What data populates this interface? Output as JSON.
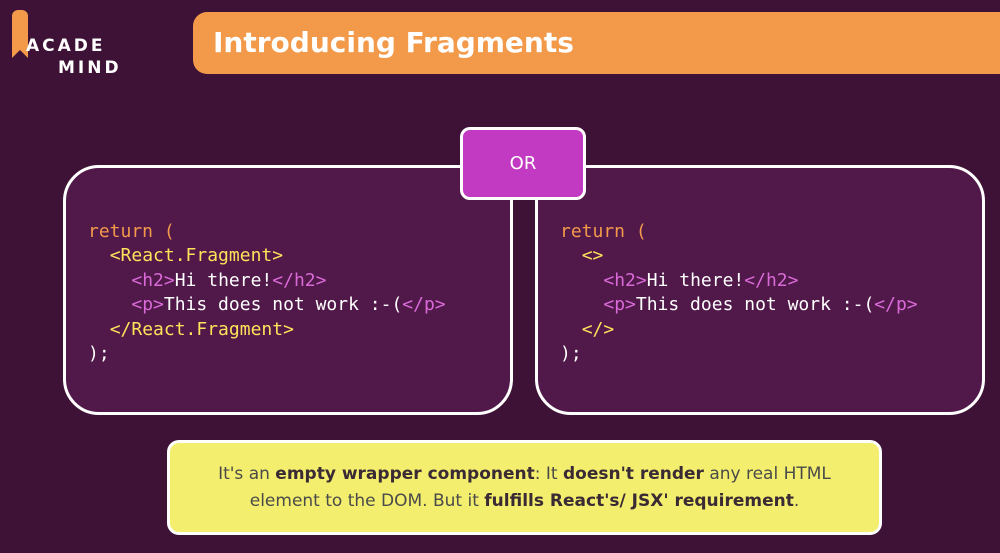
{
  "logo": {
    "line1": "ACADE",
    "line2": "MIND"
  },
  "title": "Introducing Fragments",
  "or_label": "OR",
  "left_code": {
    "l1_kw": "return (",
    "l2_tag": "<React.Fragment>",
    "l3_open": "<h2>",
    "l3_text": "Hi there!",
    "l3_close": "</h2>",
    "l4_open": "<p>",
    "l4_text": "This does not work :-(",
    "l4_close": "</p>",
    "l5_tag": "</React.Fragment>",
    "l6": ");"
  },
  "right_code": {
    "l1_kw": "return (",
    "l2_tag": "<>",
    "l3_open": "<h2>",
    "l3_text": "Hi there!",
    "l3_close": "</h2>",
    "l4_open": "<p>",
    "l4_text": "This does not work :-(",
    "l4_close": "</p>",
    "l5_tag": "</>",
    "l6": ");"
  },
  "note": {
    "part1": "It's an ",
    "bold1": "empty wrapper component",
    "part2": ": It ",
    "bold2": "doesn't render",
    "part3": " any real HTML element to the DOM. But it ",
    "bold3": "fulfills React's/ JSX' requirement",
    "part4": "."
  },
  "colors": {
    "background": "#3e1136",
    "box": "#51194a",
    "title_bar": "#f2994a",
    "or_badge": "#c33ac2",
    "note_bg": "#f3ee6e",
    "keyword": "#f2994a",
    "tag_yellow": "#ffe15a",
    "tag_pink": "#d96ad8"
  }
}
